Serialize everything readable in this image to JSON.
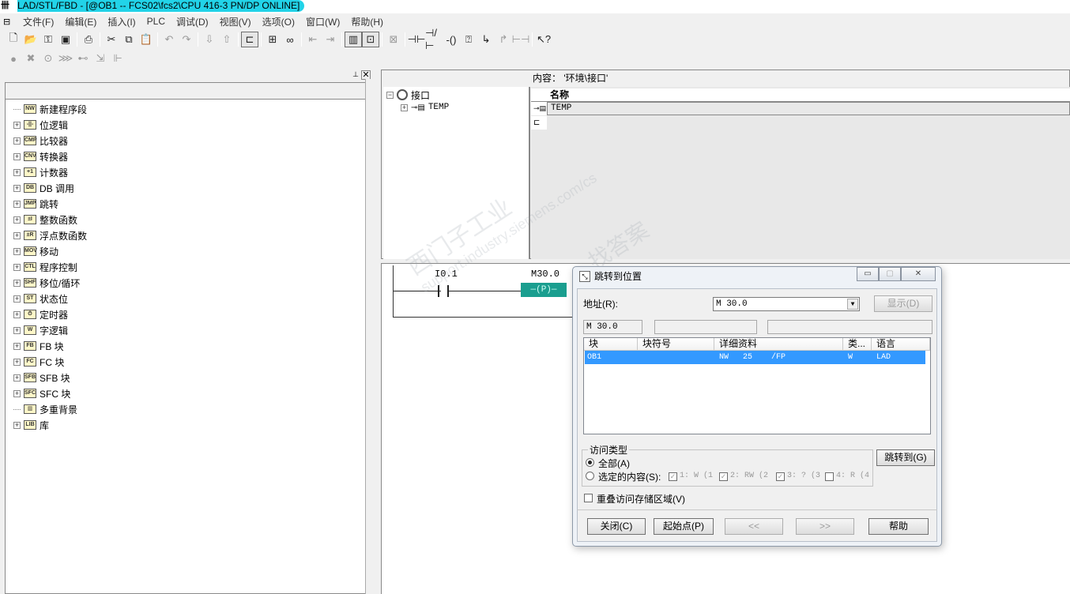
{
  "window": {
    "title": "LAD/STL/FBD  - [@OB1 -- FCS02\\fcs2\\CPU 416-3 PN/DP  ONLINE]"
  },
  "menu": [
    "文件(F)",
    "编辑(E)",
    "插入(I)",
    "PLC",
    "调试(D)",
    "视图(V)",
    "选项(O)",
    "窗口(W)",
    "帮助(H)"
  ],
  "catalog": {
    "items": [
      {
        "label": "新建程序段",
        "icon": "new-network-icon",
        "expandable": false
      },
      {
        "label": "位逻辑",
        "icon": "bit-logic-icon",
        "expandable": true
      },
      {
        "label": "比较器",
        "icon": "comparator-icon",
        "expandable": true
      },
      {
        "label": "转换器",
        "icon": "converter-icon",
        "expandable": true
      },
      {
        "label": "计数器",
        "icon": "counter-icon",
        "expandable": true
      },
      {
        "label": "DB 调用",
        "icon": "db-call-icon",
        "expandable": true
      },
      {
        "label": "跳转",
        "icon": "jump-icon",
        "expandable": true
      },
      {
        "label": "整数函数",
        "icon": "integer-function-icon",
        "expandable": true
      },
      {
        "label": "浮点数函数",
        "icon": "float-function-icon",
        "expandable": true
      },
      {
        "label": "移动",
        "icon": "move-icon",
        "expandable": true
      },
      {
        "label": "程序控制",
        "icon": "program-control-icon",
        "expandable": true
      },
      {
        "label": "移位/循环",
        "icon": "shift-rotate-icon",
        "expandable": true
      },
      {
        "label": "状态位",
        "icon": "status-bit-icon",
        "expandable": true
      },
      {
        "label": "定时器",
        "icon": "timer-icon",
        "expandable": true
      },
      {
        "label": "字逻辑",
        "icon": "word-logic-icon",
        "expandable": true
      },
      {
        "label": "FB 块",
        "icon": "fb-block-icon",
        "expandable": true
      },
      {
        "label": "FC 块",
        "icon": "fc-block-icon",
        "expandable": true
      },
      {
        "label": "SFB 块",
        "icon": "sfb-block-icon",
        "expandable": true
      },
      {
        "label": "SFC 块",
        "icon": "sfc-block-icon",
        "expandable": true
      },
      {
        "label": "多重背景",
        "icon": "multi-instance-icon",
        "expandable": false
      },
      {
        "label": "库",
        "icon": "library-icon",
        "expandable": true
      }
    ]
  },
  "interface": {
    "content_label": "内容：  '环境\\接口'",
    "tree_root": "接口",
    "tree_child": "TEMP",
    "column_name": "名称",
    "rows": [
      "TEMP"
    ]
  },
  "ladder": {
    "contact_address": "I0.1",
    "coil_address": "M30.0",
    "coil_type": "P"
  },
  "dialog": {
    "title": "跳转到位置",
    "address_label": "地址(R):",
    "address_value": "M      30.0",
    "display_button": "显示(D)",
    "field1": "M      30.0",
    "field2": "",
    "field3": "",
    "columns": [
      "块",
      "块符号",
      "详细资料",
      "类...",
      "语言"
    ],
    "rows": [
      {
        "block": "OB1",
        "symbol": "",
        "details": "NW   25    /FP",
        "type": "W",
        "language": "LAD"
      }
    ],
    "access_group_label": "访问类型",
    "radio_all": "全部(A)",
    "radio_selected": "选定的内容(S):",
    "access_options": [
      "1: W (1",
      "2: RW (2",
      "3: ? (3",
      "4: R (4"
    ],
    "goto_button": "跳转到(G)",
    "overlap_label": "重叠访问存储区域(V)",
    "close_button": "关闭(C)",
    "origin_button": "起始点(P)",
    "prev_button": "<<",
    "next_button": ">>",
    "help_button": "帮助"
  },
  "watermark": [
    "西门子工业",
    "找答案",
    "support.industry.siemens.com/cs"
  ],
  "colors": {
    "title_highlight": "#22d3e8",
    "selection": "#3399ff",
    "coil_active": "#1a9e8f"
  }
}
